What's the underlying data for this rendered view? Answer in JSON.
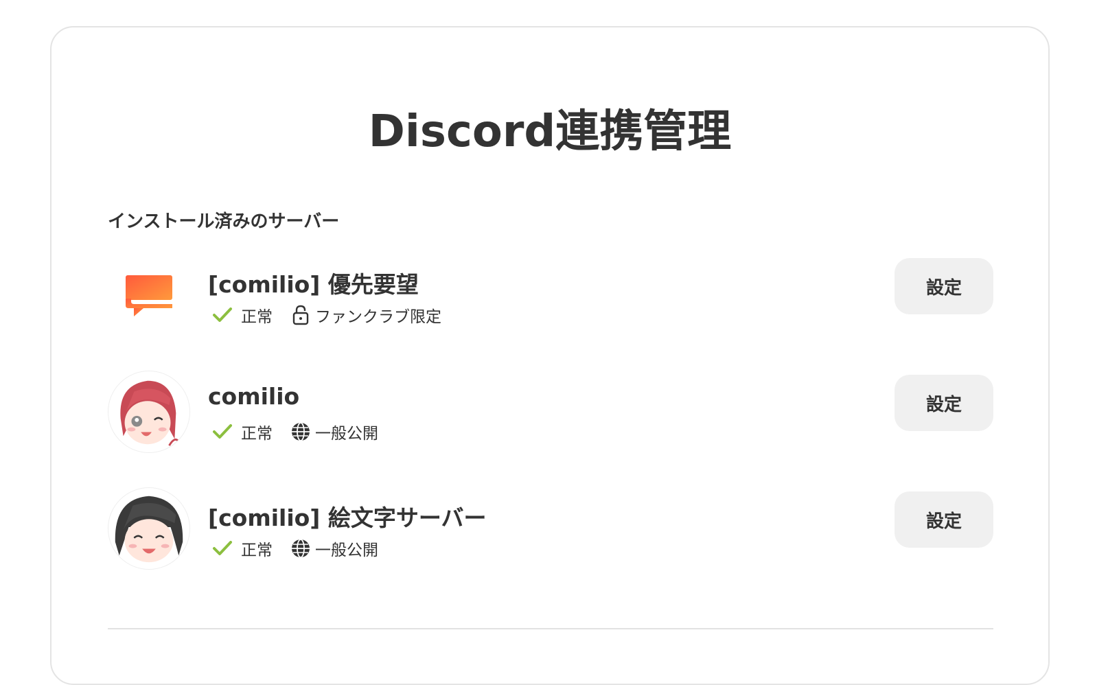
{
  "page": {
    "title": "Discord連携管理"
  },
  "section": {
    "heading": "インストール済みのサーバー"
  },
  "servers": [
    {
      "name": "[comilio] 優先要望",
      "icon": "chat-bubble-icon",
      "status": "正常",
      "visibility_icon": "lock-icon",
      "visibility": "ファンクラブ限定",
      "button_label": "設定"
    },
    {
      "name": "comilio",
      "icon": "avatar-red-hair",
      "status": "正常",
      "visibility_icon": "globe-icon",
      "visibility": "一般公開",
      "button_label": "設定"
    },
    {
      "name": "[comilio] 絵文字サーバー",
      "icon": "avatar-dark-hair",
      "status": "正常",
      "visibility_icon": "globe-icon",
      "visibility": "一般公開",
      "button_label": "設定"
    }
  ],
  "colors": {
    "check": "#8cbf3f",
    "accent_gradient_start": "#ff5a3c",
    "accent_gradient_end": "#ff9a3c",
    "button_bg": "#f0f0f0",
    "text": "#333333"
  }
}
